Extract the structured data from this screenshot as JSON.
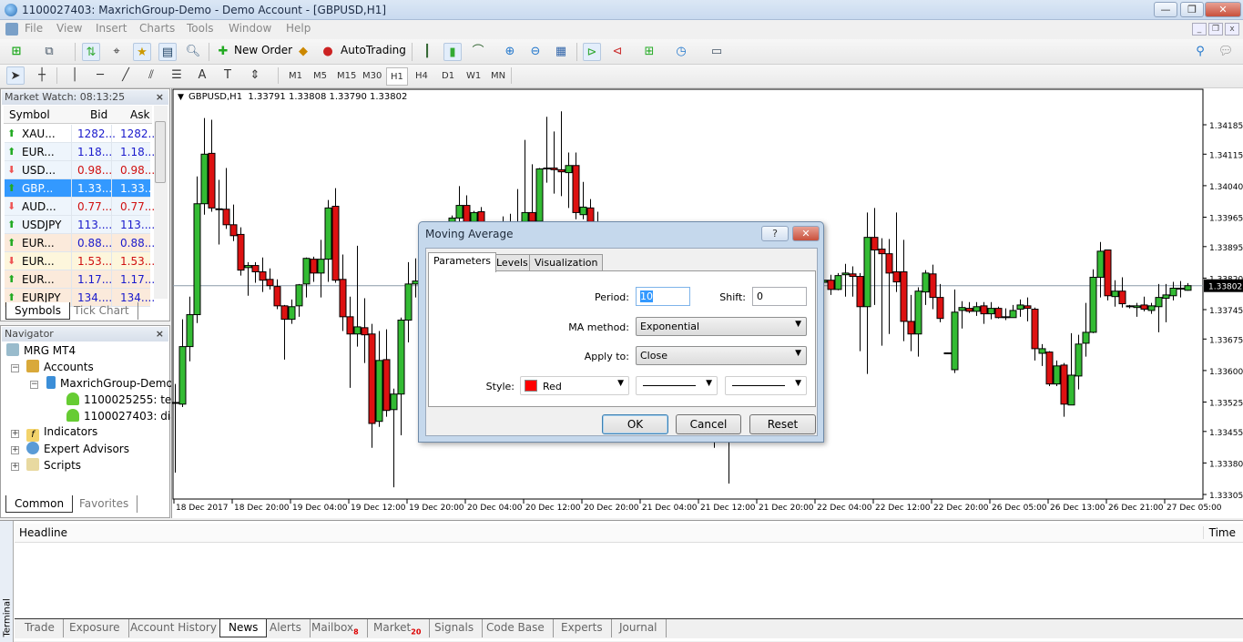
{
  "window": {
    "title": "1100027403: MaxrichGroup-Demo - Demo Account - [GBPUSD,H1]",
    "buttons": [
      "minimize",
      "restore",
      "close"
    ]
  },
  "menu": [
    "File",
    "View",
    "Insert",
    "Charts",
    "Tools",
    "Window",
    "Help"
  ],
  "toolbar": {
    "new_order": "New Order",
    "autotrading": "AutoTrading",
    "timeframes": [
      "M1",
      "M5",
      "M15",
      "M30",
      "H1",
      "H4",
      "D1",
      "W1",
      "MN"
    ],
    "active_timeframe": "H1",
    "draw_text_tool": "A"
  },
  "market_watch": {
    "title": "Market Watch: 08:13:25",
    "columns": [
      "Symbol",
      "Bid",
      "Ask"
    ],
    "rows": [
      {
        "symbol": "XAU...",
        "bid": "1282...",
        "ask": "1282...",
        "dir": "up"
      },
      {
        "symbol": "EUR...",
        "bid": "1.18...",
        "ask": "1.18...",
        "dir": "up"
      },
      {
        "symbol": "USD...",
        "bid": "0.98...",
        "ask": "0.98...",
        "dir": "down"
      },
      {
        "symbol": "GBP...",
        "bid": "1.33...",
        "ask": "1.33...",
        "dir": "up",
        "selected": true
      },
      {
        "symbol": "AUD...",
        "bid": "0.77...",
        "ask": "0.77...",
        "dir": "down"
      },
      {
        "symbol": "USDJPY",
        "bid": "113....",
        "ask": "113....",
        "dir": "up"
      },
      {
        "symbol": "EUR...",
        "bid": "0.88...",
        "ask": "0.88...",
        "dir": "up"
      },
      {
        "symbol": "EUR...",
        "bid": "1.53...",
        "ask": "1.53...",
        "dir": "down"
      },
      {
        "symbol": "EUR...",
        "bid": "1.17...",
        "ask": "1.17...",
        "dir": "up"
      },
      {
        "symbol": "EURJPY",
        "bid": "134....",
        "ask": "134....",
        "dir": "up"
      }
    ],
    "tabs": [
      "Symbols",
      "Tick Chart"
    ],
    "colors": {
      "up": "#1a1acc",
      "down": "#d01010",
      "selected": "#3399ff"
    }
  },
  "navigator": {
    "title": "Navigator",
    "root": "MRG MT4",
    "accounts": "Accounts",
    "server": "MaxrichGroup-Demo",
    "account1": "1100025255: testo",
    "account2": "1100027403: diast",
    "indicators": "Indicators",
    "experts": "Expert Advisors",
    "scripts": "Scripts",
    "tabs": [
      "Common",
      "Favorites"
    ]
  },
  "chart": {
    "header": "GBPUSD,H1  1.33791 1.33808 1.33790 1.33802",
    "current_price": "1.33802"
  },
  "chart_data": {
    "type": "candlestick",
    "symbol": "GBPUSD",
    "timeframe": "H1",
    "ylim": [
      1.3329,
      1.3423
    ],
    "y_ticks": [
      "1.34185",
      "1.34115",
      "1.34040",
      "1.33965",
      "1.33895",
      "1.33820",
      "1.33745",
      "1.33675",
      "1.33600",
      "1.33525",
      "1.33455",
      "1.33380",
      "1.33305"
    ],
    "x_ticks": [
      "18 Dec 2017",
      "18 Dec 20:00",
      "19 Dec 04:00",
      "19 Dec 12:00",
      "19 Dec 20:00",
      "20 Dec 04:00",
      "20 Dec 12:00",
      "20 Dec 20:00",
      "21 Dec 04:00",
      "21 Dec 12:00",
      "21 Dec 20:00",
      "22 Dec 04:00",
      "22 Dec 12:00",
      "22 Dec 20:00",
      "26 Dec 05:00",
      "26 Dec 13:00",
      "26 Dec 21:00",
      "27 Dec 05:00"
    ],
    "bars_per_x_tick": 8,
    "current_price": 1.33802,
    "colors": {
      "bull": "#33bb33",
      "bear": "#dd1111",
      "wick": "#000000",
      "price_line": "#8a9aa8"
    },
    "ohlc": [
      [
        1.33524,
        1.33568,
        1.33357,
        1.33522
      ],
      [
        1.3352,
        1.33722,
        1.33513,
        1.33657
      ],
      [
        1.33657,
        1.33776,
        1.33622,
        1.33733
      ],
      [
        1.33733,
        1.34062,
        1.33713,
        1.33997
      ],
      [
        1.33997,
        1.34201,
        1.33971,
        1.34115
      ],
      [
        1.34117,
        1.34197,
        1.33978,
        1.33987
      ],
      [
        1.33985,
        1.34054,
        1.339,
        1.33984
      ],
      [
        1.33984,
        1.34082,
        1.33937,
        1.33947
      ],
      [
        1.33947,
        1.33995,
        1.33908,
        1.33921
      ],
      [
        1.33924,
        1.33941,
        1.33826,
        1.33839
      ],
      [
        1.33845,
        1.33858,
        1.33778,
        1.3385
      ],
      [
        1.3385,
        1.33858,
        1.33809,
        1.33835
      ],
      [
        1.33835,
        1.33869,
        1.33787,
        1.33815
      ],
      [
        1.33817,
        1.33843,
        1.33793,
        1.33802
      ],
      [
        1.338,
        1.33817,
        1.33746,
        1.33754
      ],
      [
        1.33754,
        1.33756,
        1.33626,
        1.33722
      ],
      [
        1.33722,
        1.33769,
        1.33711,
        1.33752
      ],
      [
        1.33754,
        1.33806,
        1.33728,
        1.33804
      ],
      [
        1.33806,
        1.33869,
        1.33774,
        1.33867
      ],
      [
        1.33865,
        1.33871,
        1.33811,
        1.33832
      ],
      [
        1.33832,
        1.33911,
        1.33774,
        1.33865
      ],
      [
        1.33865,
        1.34006,
        1.33811,
        1.33987
      ],
      [
        1.33991,
        1.34034,
        1.33809,
        1.33815
      ],
      [
        1.33817,
        1.33876,
        1.33694,
        1.33728
      ],
      [
        1.33728,
        1.33776,
        1.33559,
        1.33687
      ],
      [
        1.33687,
        1.33897,
        1.33657,
        1.33704
      ],
      [
        1.33702,
        1.33772,
        1.33618,
        1.33685
      ],
      [
        1.33687,
        1.33711,
        1.33416,
        1.33474
      ],
      [
        1.33479,
        1.33694,
        1.33466,
        1.33624
      ],
      [
        1.33626,
        1.33698,
        1.3349,
        1.33505
      ],
      [
        1.33507,
        1.33557,
        1.33322,
        1.33544
      ],
      [
        1.33544,
        1.33726,
        1.33446,
        1.3372
      ],
      [
        1.3372,
        1.33858,
        1.33667,
        1.33806
      ],
      [
        1.33806,
        1.33867,
        1.33774,
        1.33813
      ],
      null,
      null,
      null,
      null,
      [
        1.33911,
        1.33969,
        1.339,
        1.33963
      ],
      [
        1.33963,
        1.34039,
        1.3395,
        1.33993
      ],
      [
        1.33993,
        1.34017,
        1.3393,
        1.33943
      ],
      [
        1.33943,
        1.3398,
        1.33935,
        1.33976
      ],
      [
        1.33978,
        1.33989,
        1.33925,
        1.3394
      ],
      null,
      null,
      [
        1.339,
        1.33967,
        1.3388,
        1.3392
      ],
      [
        1.3392,
        1.33973,
        1.3389,
        1.3393
      ],
      [
        1.3393,
        1.34032,
        1.339,
        1.3395
      ],
      [
        1.3395,
        1.34149,
        1.3393,
        1.33976
      ],
      [
        1.33976,
        1.34091,
        1.3394,
        1.33955
      ],
      [
        1.33955,
        1.34082,
        1.33945,
        1.3408
      ],
      [
        1.3408,
        1.34204,
        1.34047,
        1.34082
      ],
      [
        1.34082,
        1.34169,
        1.34021,
        1.34078
      ],
      [
        1.34078,
        1.34217,
        1.34015,
        1.34073
      ],
      [
        1.34071,
        1.34119,
        1.33987,
        1.34088
      ],
      [
        1.34088,
        1.34119,
        1.3396,
        1.33976
      ],
      [
        1.33971,
        1.34049,
        1.3396,
        1.33989
      ],
      [
        1.33987,
        1.34008,
        1.3392,
        1.3394
      ],
      [
        1.3394,
        1.33978,
        1.339,
        1.3393
      ],
      null,
      null,
      null,
      null,
      null,
      null,
      null,
      null,
      null,
      null,
      null,
      null,
      null,
      null,
      null,
      [
        1.337,
        1.3375,
        1.33416,
        1.3368
      ],
      null,
      [
        1.3368,
        1.3376,
        1.33331,
        1.3372
      ],
      null,
      null,
      null,
      null,
      null,
      null,
      null,
      null,
      null,
      null,
      null,
      null,
      [
        1.3381,
        1.33845,
        1.3379,
        1.33815
      ],
      [
        1.33815,
        1.33828,
        1.3378,
        1.33793
      ],
      [
        1.33793,
        1.33832,
        1.33791,
        1.33826
      ],
      [
        1.33828,
        1.33854,
        1.33776,
        1.33832
      ],
      [
        1.3383,
        1.33848,
        1.33776,
        1.33824
      ],
      [
        1.33824,
        1.33832,
        1.33646,
        1.33752
      ],
      [
        1.33752,
        1.33976,
        1.33592,
        1.33917
      ],
      [
        1.33917,
        1.33987,
        1.33756,
        1.33887
      ],
      [
        1.33889,
        1.33915,
        1.33659,
        1.33878
      ],
      [
        1.33878,
        1.33913,
        1.33687,
        1.33832
      ],
      [
        1.33835,
        1.33976,
        1.33787,
        1.33811
      ],
      [
        1.33835,
        1.33911,
        1.3367,
        1.33717
      ],
      [
        1.33717,
        1.3378,
        1.33646,
        1.33687
      ],
      [
        1.33687,
        1.33798,
        1.33633,
        1.33789
      ],
      [
        1.33787,
        1.33839,
        1.33756,
        1.33832
      ],
      [
        1.3383,
        1.33852,
        1.33746,
        1.33774
      ],
      [
        1.33774,
        1.33806,
        1.33715,
        1.33724
      ],
      [
        1.33641,
        1.33643,
        1.33641,
        1.33642
      ],
      [
        1.33602,
        1.33793,
        1.33594,
        1.33739
      ],
      [
        1.33743,
        1.33765,
        1.337,
        1.3375
      ],
      [
        1.33748,
        1.33763,
        1.33737,
        1.33741
      ],
      [
        1.33741,
        1.33763,
        1.3373,
        1.33752
      ],
      [
        1.33754,
        1.33763,
        1.33711,
        1.33735
      ],
      [
        1.33735,
        1.33763,
        1.33722,
        1.33748
      ],
      [
        1.33748,
        1.33752,
        1.33724,
        1.33726
      ],
      [
        1.33727,
        1.33748,
        1.3372,
        1.33728
      ],
      [
        1.33726,
        1.33756,
        1.33726,
        1.33743
      ],
      [
        1.33746,
        1.33769,
        1.33728,
        1.33756
      ],
      [
        1.33754,
        1.33774,
        1.33717,
        1.33748
      ],
      [
        1.33746,
        1.3375,
        1.33624,
        1.33652
      ],
      [
        1.33641,
        1.33663,
        1.33611,
        1.33652
      ],
      [
        1.33644,
        1.33646,
        1.33563,
        1.33568
      ],
      [
        1.33568,
        1.33624,
        1.33563,
        1.33611
      ],
      [
        1.33613,
        1.33618,
        1.3349,
        1.3352
      ],
      [
        1.33518,
        1.33689,
        1.33518,
        1.33589
      ],
      [
        1.33587,
        1.33685,
        1.33555,
        1.33663
      ],
      [
        1.33665,
        1.33761,
        1.33633,
        1.33691
      ],
      [
        1.33691,
        1.33841,
        1.33689,
        1.33822
      ],
      [
        1.33822,
        1.33906,
        1.33774,
        1.33884
      ],
      [
        1.33887,
        1.33887,
        1.33767,
        1.33778
      ],
      [
        1.33776,
        1.33815,
        1.33752,
        1.33789
      ],
      [
        1.33789,
        1.33822,
        1.3375,
        1.33759
      ],
      [
        1.33754,
        1.33756,
        1.33748,
        1.33753
      ],
      [
        1.3375,
        1.33761,
        1.33728,
        1.33754
      ],
      [
        1.33756,
        1.33776,
        1.33741,
        1.33746
      ],
      [
        1.33743,
        1.33761,
        1.33735,
        1.33754
      ],
      [
        1.33752,
        1.33806,
        1.33691,
        1.33774
      ],
      [
        1.33772,
        1.33806,
        1.33715,
        1.3378
      ],
      [
        1.33778,
        1.33811,
        1.33767,
        1.33796
      ],
      [
        1.33795,
        1.33813,
        1.33774,
        1.33796
      ],
      [
        1.33791,
        1.33808,
        1.3379,
        1.33802
      ]
    ]
  },
  "dialog": {
    "title": "Moving Average",
    "help": "?",
    "tabs": [
      "Parameters",
      "Levels",
      "Visualization"
    ],
    "period_label": "Period:",
    "period_value": "10",
    "shift_label": "Shift:",
    "shift_value": "0",
    "method_label": "MA method:",
    "method_value": "Exponential",
    "apply_label": "Apply to:",
    "apply_value": "Close",
    "style_label": "Style:",
    "style_color_name": "Red",
    "style_color": "#ff0000",
    "ok": "OK",
    "cancel": "Cancel",
    "reset": "Reset"
  },
  "terminal": {
    "side_label": "Terminal",
    "columns": [
      "Headline",
      "Time"
    ],
    "tabs": [
      {
        "label": "Trade"
      },
      {
        "label": "Exposure"
      },
      {
        "label": "Account History"
      },
      {
        "label": "News",
        "active": true
      },
      {
        "label": "Alerts"
      },
      {
        "label": "Mailbox",
        "badge": "8"
      },
      {
        "label": "Market",
        "badge": "20"
      },
      {
        "label": "Signals"
      },
      {
        "label": "Code Base"
      },
      {
        "label": "Experts"
      },
      {
        "label": "Journal"
      }
    ]
  }
}
